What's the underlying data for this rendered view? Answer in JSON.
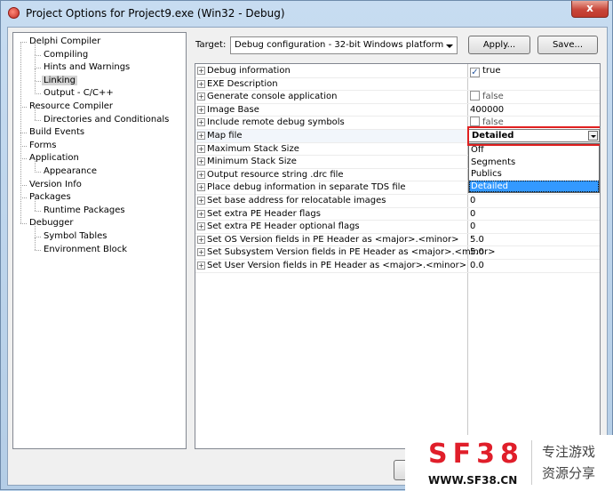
{
  "window": {
    "title": "Project Options for Project9.exe  (Win32 - Debug)",
    "close_glyph": "x"
  },
  "tree": {
    "items": [
      {
        "label": "Delphi Compiler",
        "level": 0
      },
      {
        "label": "Compiling",
        "level": 1
      },
      {
        "label": "Hints and Warnings",
        "level": 1
      },
      {
        "label": "Linking",
        "level": 1,
        "selected": true
      },
      {
        "label": "Output - C/C++",
        "level": 1
      },
      {
        "label": "Resource Compiler",
        "level": 0
      },
      {
        "label": "Directories and Conditionals",
        "level": 1
      },
      {
        "label": "Build Events",
        "level": 0
      },
      {
        "label": "Forms",
        "level": 0
      },
      {
        "label": "Application",
        "level": 0
      },
      {
        "label": "Appearance",
        "level": 1
      },
      {
        "label": "Version Info",
        "level": 0
      },
      {
        "label": "Packages",
        "level": 0
      },
      {
        "label": "Runtime Packages",
        "level": 1
      },
      {
        "label": "Debugger",
        "level": 0
      },
      {
        "label": "Symbol Tables",
        "level": 1
      },
      {
        "label": "Environment Block",
        "level": 1
      }
    ]
  },
  "target": {
    "label": "Target:",
    "value": "Debug configuration - 32-bit Windows platform",
    "apply_label": "Apply...",
    "save_label": "Save..."
  },
  "grid": {
    "rows": [
      {
        "name": "Debug information",
        "value": "true",
        "checkbox": true,
        "checked": true
      },
      {
        "name": "EXE Description",
        "value": ""
      },
      {
        "name": "Generate console application",
        "value": "false",
        "checkbox": true,
        "checked": false
      },
      {
        "name": "Image Base",
        "value": "400000"
      },
      {
        "name": "Include remote debug symbols",
        "value": "false",
        "checkbox": true,
        "checked": false
      },
      {
        "name": "Map file",
        "value": "Detailed"
      },
      {
        "name": "Maximum Stack Size",
        "value": "Off"
      },
      {
        "name": "Minimum Stack Size",
        "value": "Segments"
      },
      {
        "name": "Output resource string .drc file",
        "value": "Publics"
      },
      {
        "name": "Place debug information in separate TDS file",
        "value": ""
      },
      {
        "name": "Set base address for relocatable images",
        "value": "0"
      },
      {
        "name": "Set extra PE Header flags",
        "value": "0"
      },
      {
        "name": "Set extra PE Header optional flags",
        "value": "0"
      },
      {
        "name": "Set OS Version fields in PE Header as <major>.<minor>",
        "value": "5.0"
      },
      {
        "name": "Set Subsystem Version fields in PE Header as <major>.<minor>",
        "value": "5.0"
      },
      {
        "name": "Set User Version fields in PE Header as <major>.<minor>",
        "value": "0.0"
      }
    ],
    "map_file_combo": {
      "value": "Detailed",
      "options": [
        "Off",
        "Segments",
        "Publics",
        "Detailed"
      ],
      "selected": "Detailed"
    }
  },
  "watermark": {
    "big": "SF38",
    "url": "WWW.SF38.CN",
    "cn_line1": "专注游戏",
    "cn_line2": "资源分享"
  },
  "colors": {
    "highlight": "#e02020",
    "selection": "#3399ff",
    "watermark_red": "#e01e2a"
  }
}
